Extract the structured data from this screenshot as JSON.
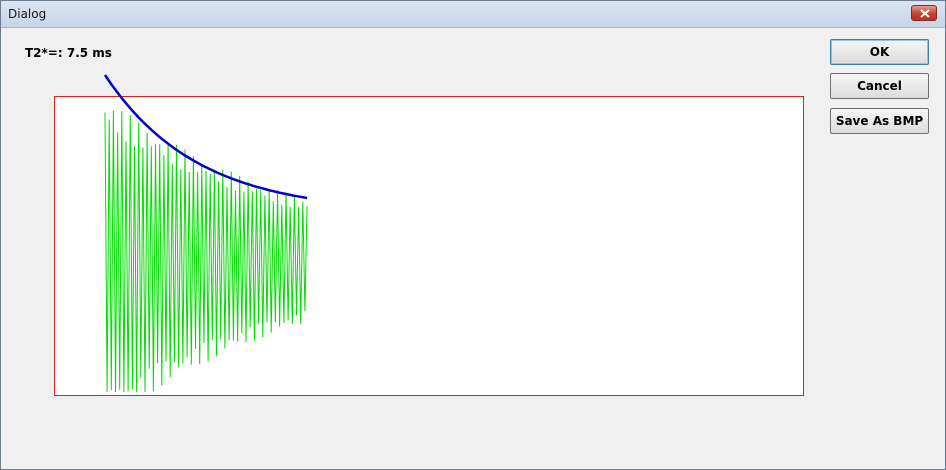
{
  "window": {
    "title": "Dialog"
  },
  "plot": {
    "t2_label": "T2*=: 7.5 ms",
    "colors": {
      "border": "#e02020",
      "signal": "#00dd00",
      "fit": "#0000cc"
    }
  },
  "buttons": {
    "ok": "OK",
    "cancel": "Cancel",
    "save_bmp": "Save As BMP"
  },
  "icons": {
    "close": "close-icon"
  }
}
